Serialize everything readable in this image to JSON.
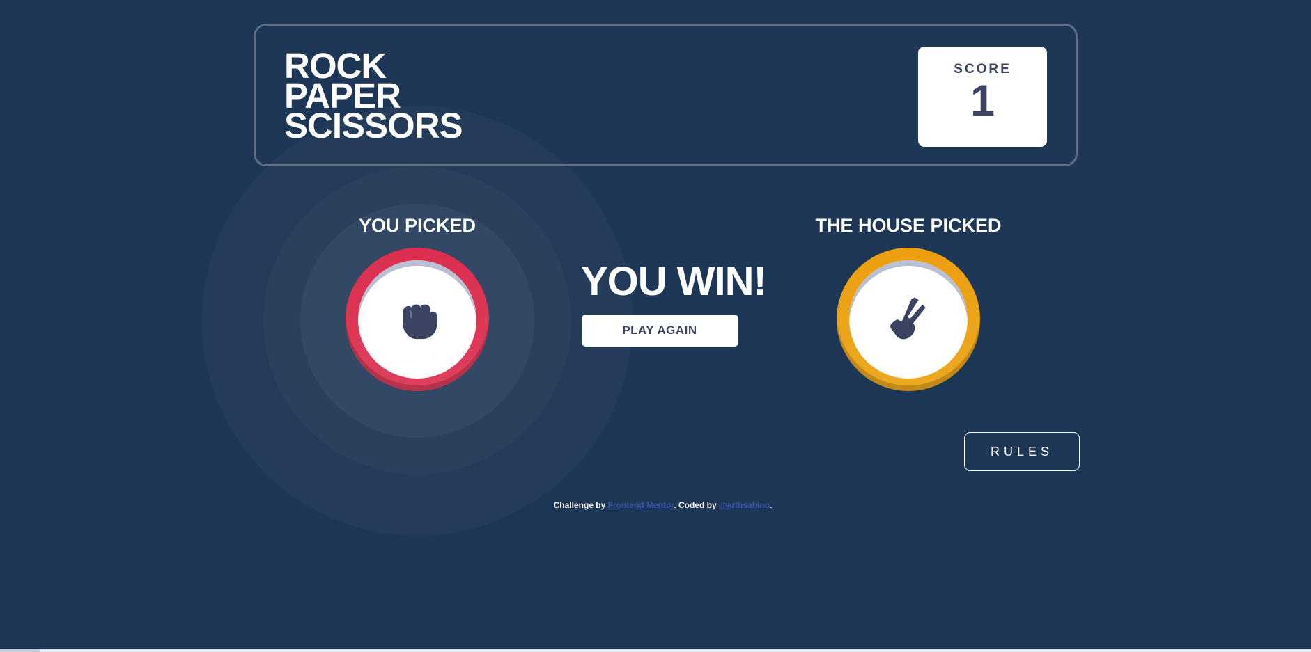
{
  "header": {
    "title_lines": [
      "ROCK",
      "PAPER",
      "SCISSORS"
    ],
    "score_label": "SCORE",
    "score_value": "1"
  },
  "game": {
    "you_label": "YOU PICKED",
    "house_label": "THE HOUSE PICKED",
    "you_pick": "rock",
    "house_pick": "scissors",
    "result": "YOU WIN!",
    "play_again_label": "PLAY AGAIN"
  },
  "rules_label": "RULES",
  "footer": {
    "prefix": "Challenge by ",
    "link1": "Frontend Mentor",
    "middle": ". Coded by ",
    "link2": "@arthsabino",
    "suffix": "."
  },
  "icons": {
    "you_pick_icon": "rock-fist-icon",
    "house_pick_icon": "scissors-hand-icon"
  },
  "colors": {
    "background": "#1f3756",
    "rock_ring": "#dc2e4e",
    "scissors_ring": "#ec9e0e",
    "text_dark": "#3b4363",
    "link": "#3e52a3"
  }
}
